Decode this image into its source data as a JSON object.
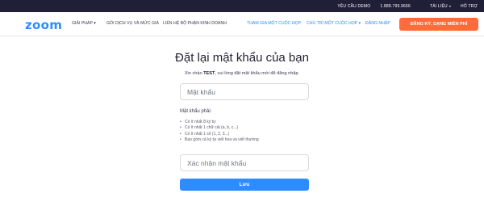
{
  "topbar": {
    "demo": "YÊU CẦU DEMO",
    "phone": "1.888.799.9666",
    "resources": "TÀI LIỆU",
    "resources_caret": "▾",
    "support": "HỖ TRỢ"
  },
  "nav": {
    "logo": "zoom",
    "solutions": "GIẢI PHÁP ▾",
    "plans": "GÓI DỊCH VỤ VÀ MỨC GIÁ",
    "contact_sales": "LIÊN HỆ BỘ PHẬN KINH DOANH",
    "join": "THAM GIA MỘT CUỘC HỌP",
    "host": "CHỦ TRÌ MỘT CUỘC HỌP ▾",
    "signin": "ĐĂNG NHẬP",
    "signup": "ĐĂNG KÝ, DẠNG MIỄN PHÍ"
  },
  "page": {
    "title": "Đặt lại mật khẩu của bạn",
    "greeting_prefix": "Xin chào ",
    "greeting_name": "TEST",
    "greeting_suffix": ", vui lòng đặt mật khẩu mới để đăng nhập."
  },
  "form": {
    "password_placeholder": "Mật khẩu",
    "confirm_placeholder": "Xác nhận mật khẩu",
    "requirements_title": "Mật khẩu phải:",
    "requirements": [
      "Có ít nhất 8 ký tự",
      "Có ít nhất 1 chữ cái (a, b, c...)",
      "Có ít nhất 1 số (1, 2, 3...)",
      "Bao gồm cả ký tự viết hoa và viết thường"
    ],
    "bullet": "•",
    "save_label": "Lưu"
  },
  "colors": {
    "brand_blue": "#2d8cff",
    "signup_orange": "#ff6c37",
    "topbar": "#1f1f38"
  }
}
